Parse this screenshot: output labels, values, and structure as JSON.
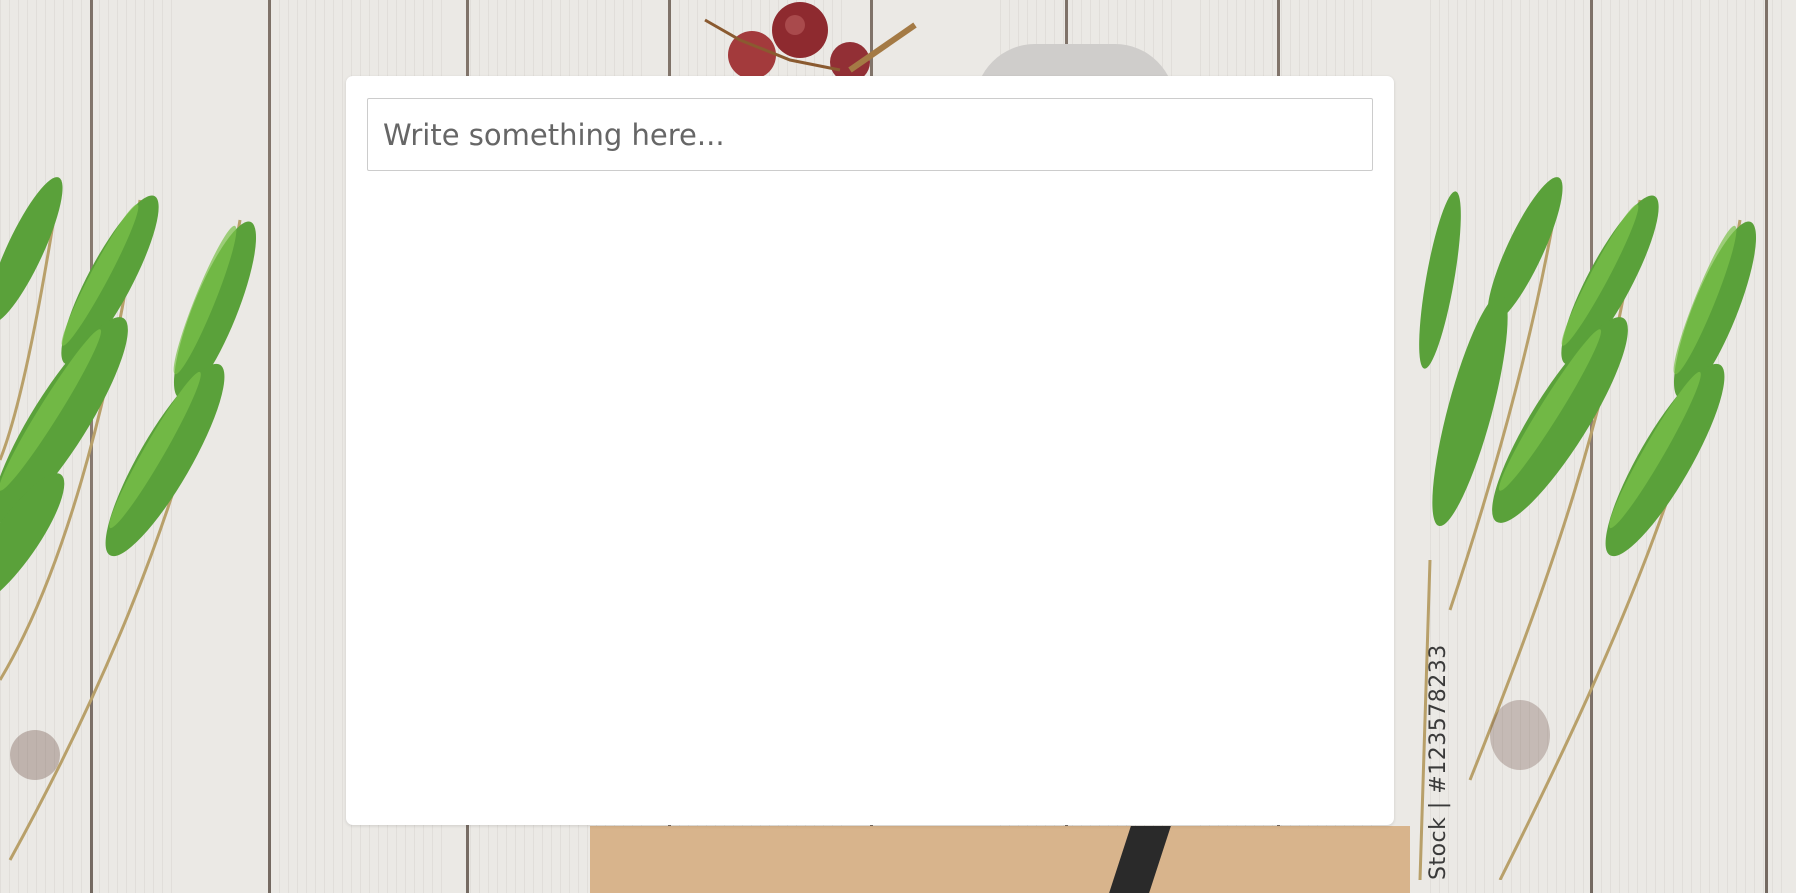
{
  "note": {
    "placeholder": "Write something here..."
  },
  "background": {
    "watermark_text": "Stock | #123578233"
  },
  "colors": {
    "card": "#ffffff",
    "input_border": "#cccccc",
    "placeholder": "#666666",
    "wheat": "#5aa13a"
  }
}
